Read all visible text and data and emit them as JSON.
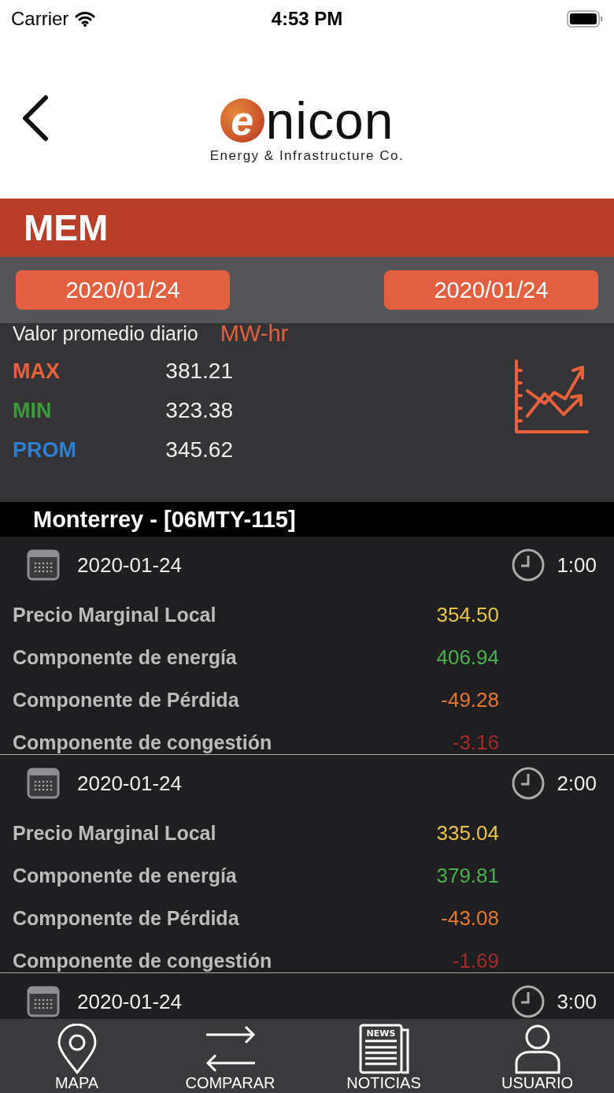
{
  "status_bar": {
    "carrier": "Carrier",
    "time": "4:53 PM"
  },
  "header": {
    "logo_mark": "e",
    "logo_name": "nicon",
    "logo_tagline": "Energy & Infrastructure Co."
  },
  "title": "MEM",
  "date_range": [
    "2020/01/24",
    "2020/01/24"
  ],
  "summary": {
    "label": "Valor promedio diario",
    "unit": "MW-hr",
    "stats": [
      {
        "label": "MAX",
        "value": "381.21",
        "color": "#e8603c"
      },
      {
        "label": "MIN",
        "value": "323.38",
        "color": "#3c9a3a"
      },
      {
        "label": "PROM",
        "value": "345.62",
        "color": "#2f7fd0"
      }
    ]
  },
  "location": "Monterrey - [06MTY-115]",
  "entries": [
    {
      "date": "2020-01-24",
      "time": "1:00",
      "rows": [
        {
          "label": "Precio Marginal Local",
          "value": "354.50",
          "color": "#e8c547"
        },
        {
          "label": "Componente de energía",
          "value": "406.94",
          "color": "#4caf50"
        },
        {
          "label": "Componente de Pérdida",
          "value": "-49.28",
          "color": "#e8772e"
        },
        {
          "label": "Componente de congestión",
          "value": "-3.16",
          "color": "#a52a2a"
        }
      ]
    },
    {
      "date": "2020-01-24",
      "time": "2:00",
      "rows": [
        {
          "label": "Precio Marginal Local",
          "value": "335.04",
          "color": "#e8c547"
        },
        {
          "label": "Componente de energía",
          "value": "379.81",
          "color": "#4caf50"
        },
        {
          "label": "Componente de Pérdida",
          "value": "-43.08",
          "color": "#e8772e"
        },
        {
          "label": "Componente de congestión",
          "value": "-1.69",
          "color": "#a52a2a"
        }
      ]
    },
    {
      "date": "2020-01-24",
      "time": "3:00"
    }
  ],
  "tabs": [
    {
      "kind": "map",
      "label": "MAPA"
    },
    {
      "kind": "compare",
      "label": "COMPARAR"
    },
    {
      "kind": "news",
      "label": "NOTICIAS",
      "icon_text": "NEWS"
    },
    {
      "kind": "user",
      "label": "USUARIO"
    }
  ]
}
